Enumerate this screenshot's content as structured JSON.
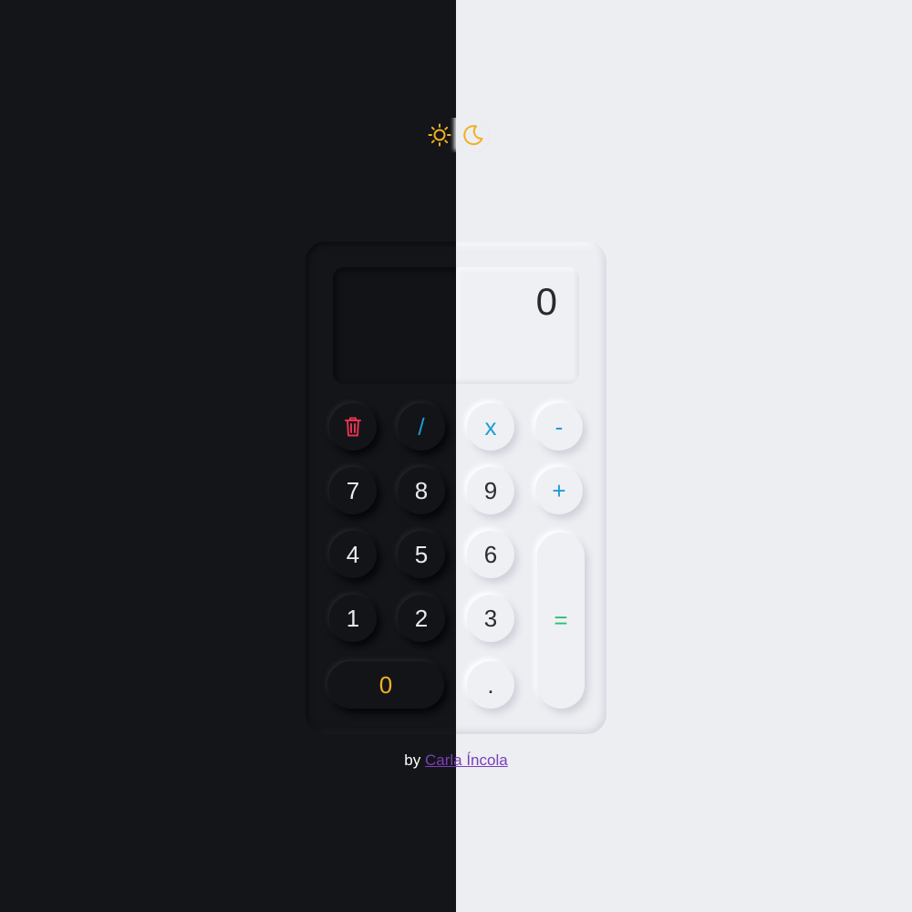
{
  "theme_toggle": {
    "light_icon": "sun-icon",
    "dark_icon": "moon-icon",
    "icon_color": "#f1b021"
  },
  "display": {
    "value": "0"
  },
  "keys": {
    "clear": {
      "icon": "trash-icon",
      "color": "#e3344e"
    },
    "divide": "/",
    "multiply": "x",
    "subtract": "-",
    "seven": "7",
    "eight": "8",
    "nine": "9",
    "add": "+",
    "four": "4",
    "five": "5",
    "six": "6",
    "equals": "=",
    "one": "1",
    "two": "2",
    "three": "3",
    "zero": "0",
    "decimal": "."
  },
  "colors": {
    "dark_bg": "#141519",
    "light_bg": "#eceef2",
    "operator": "#1f9bd7",
    "equals": "#2ebd7a",
    "zero_key": "#f1b021",
    "link": "#7a3fb8"
  },
  "credit": {
    "prefix": "by",
    "author": "Carla Íncola"
  }
}
